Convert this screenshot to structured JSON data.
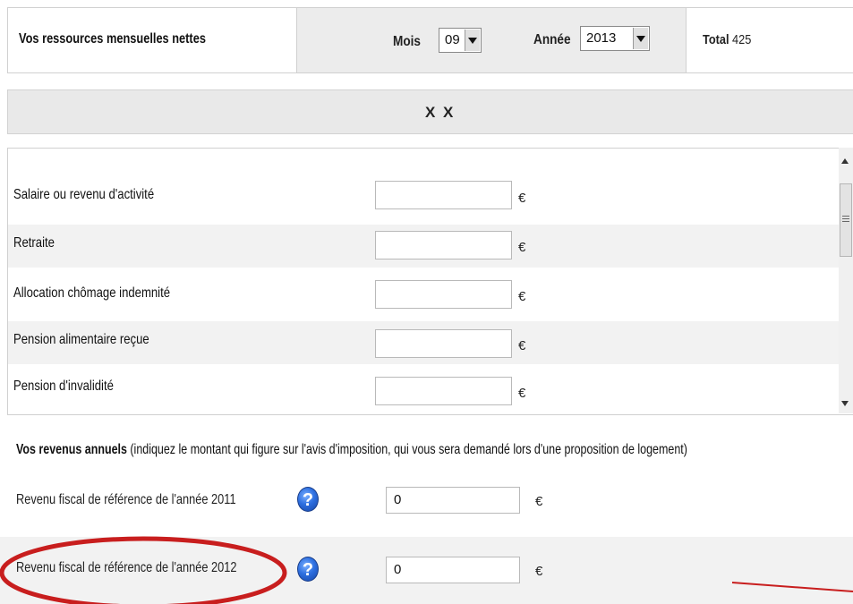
{
  "header": {
    "title": "Vos ressources mensuelles nettes",
    "mois_label": "Mois",
    "mois_value": "09",
    "annee_label": "Année",
    "annee_value": "2013",
    "total_label": "Total",
    "total_value": "425"
  },
  "section": {
    "title": "X X"
  },
  "currency_symbol": "€",
  "monthly_rows": [
    {
      "label": "Salaire ou revenu d'activité",
      "value": ""
    },
    {
      "label": "Retraite",
      "value": ""
    },
    {
      "label": "Allocation chômage indemnité",
      "value": ""
    },
    {
      "label": "Pension alimentaire reçue",
      "value": ""
    },
    {
      "label": "Pension d'invalidité",
      "value": ""
    }
  ],
  "annual": {
    "title_bold": "Vos revenus annuels",
    "title_note": "(indiquez le montant qui figure sur l'avis d'imposition, qui vous sera demandé lors d'une proposition de logement)"
  },
  "fiscal_rows": [
    {
      "label": "Revenu fiscal de référence de l'année 2011",
      "value": "0",
      "help_glyph": "?"
    },
    {
      "label": "Revenu fiscal de référence de l'année 2012",
      "value": "0",
      "help_glyph": "?"
    }
  ],
  "icons": {
    "help": "help-question-icon",
    "dropdown": "chevron-down-icon"
  },
  "colors": {
    "annotation_red": "#c81e1e",
    "help_blue": "#2d6fe0",
    "header_bg": "#ececec"
  }
}
